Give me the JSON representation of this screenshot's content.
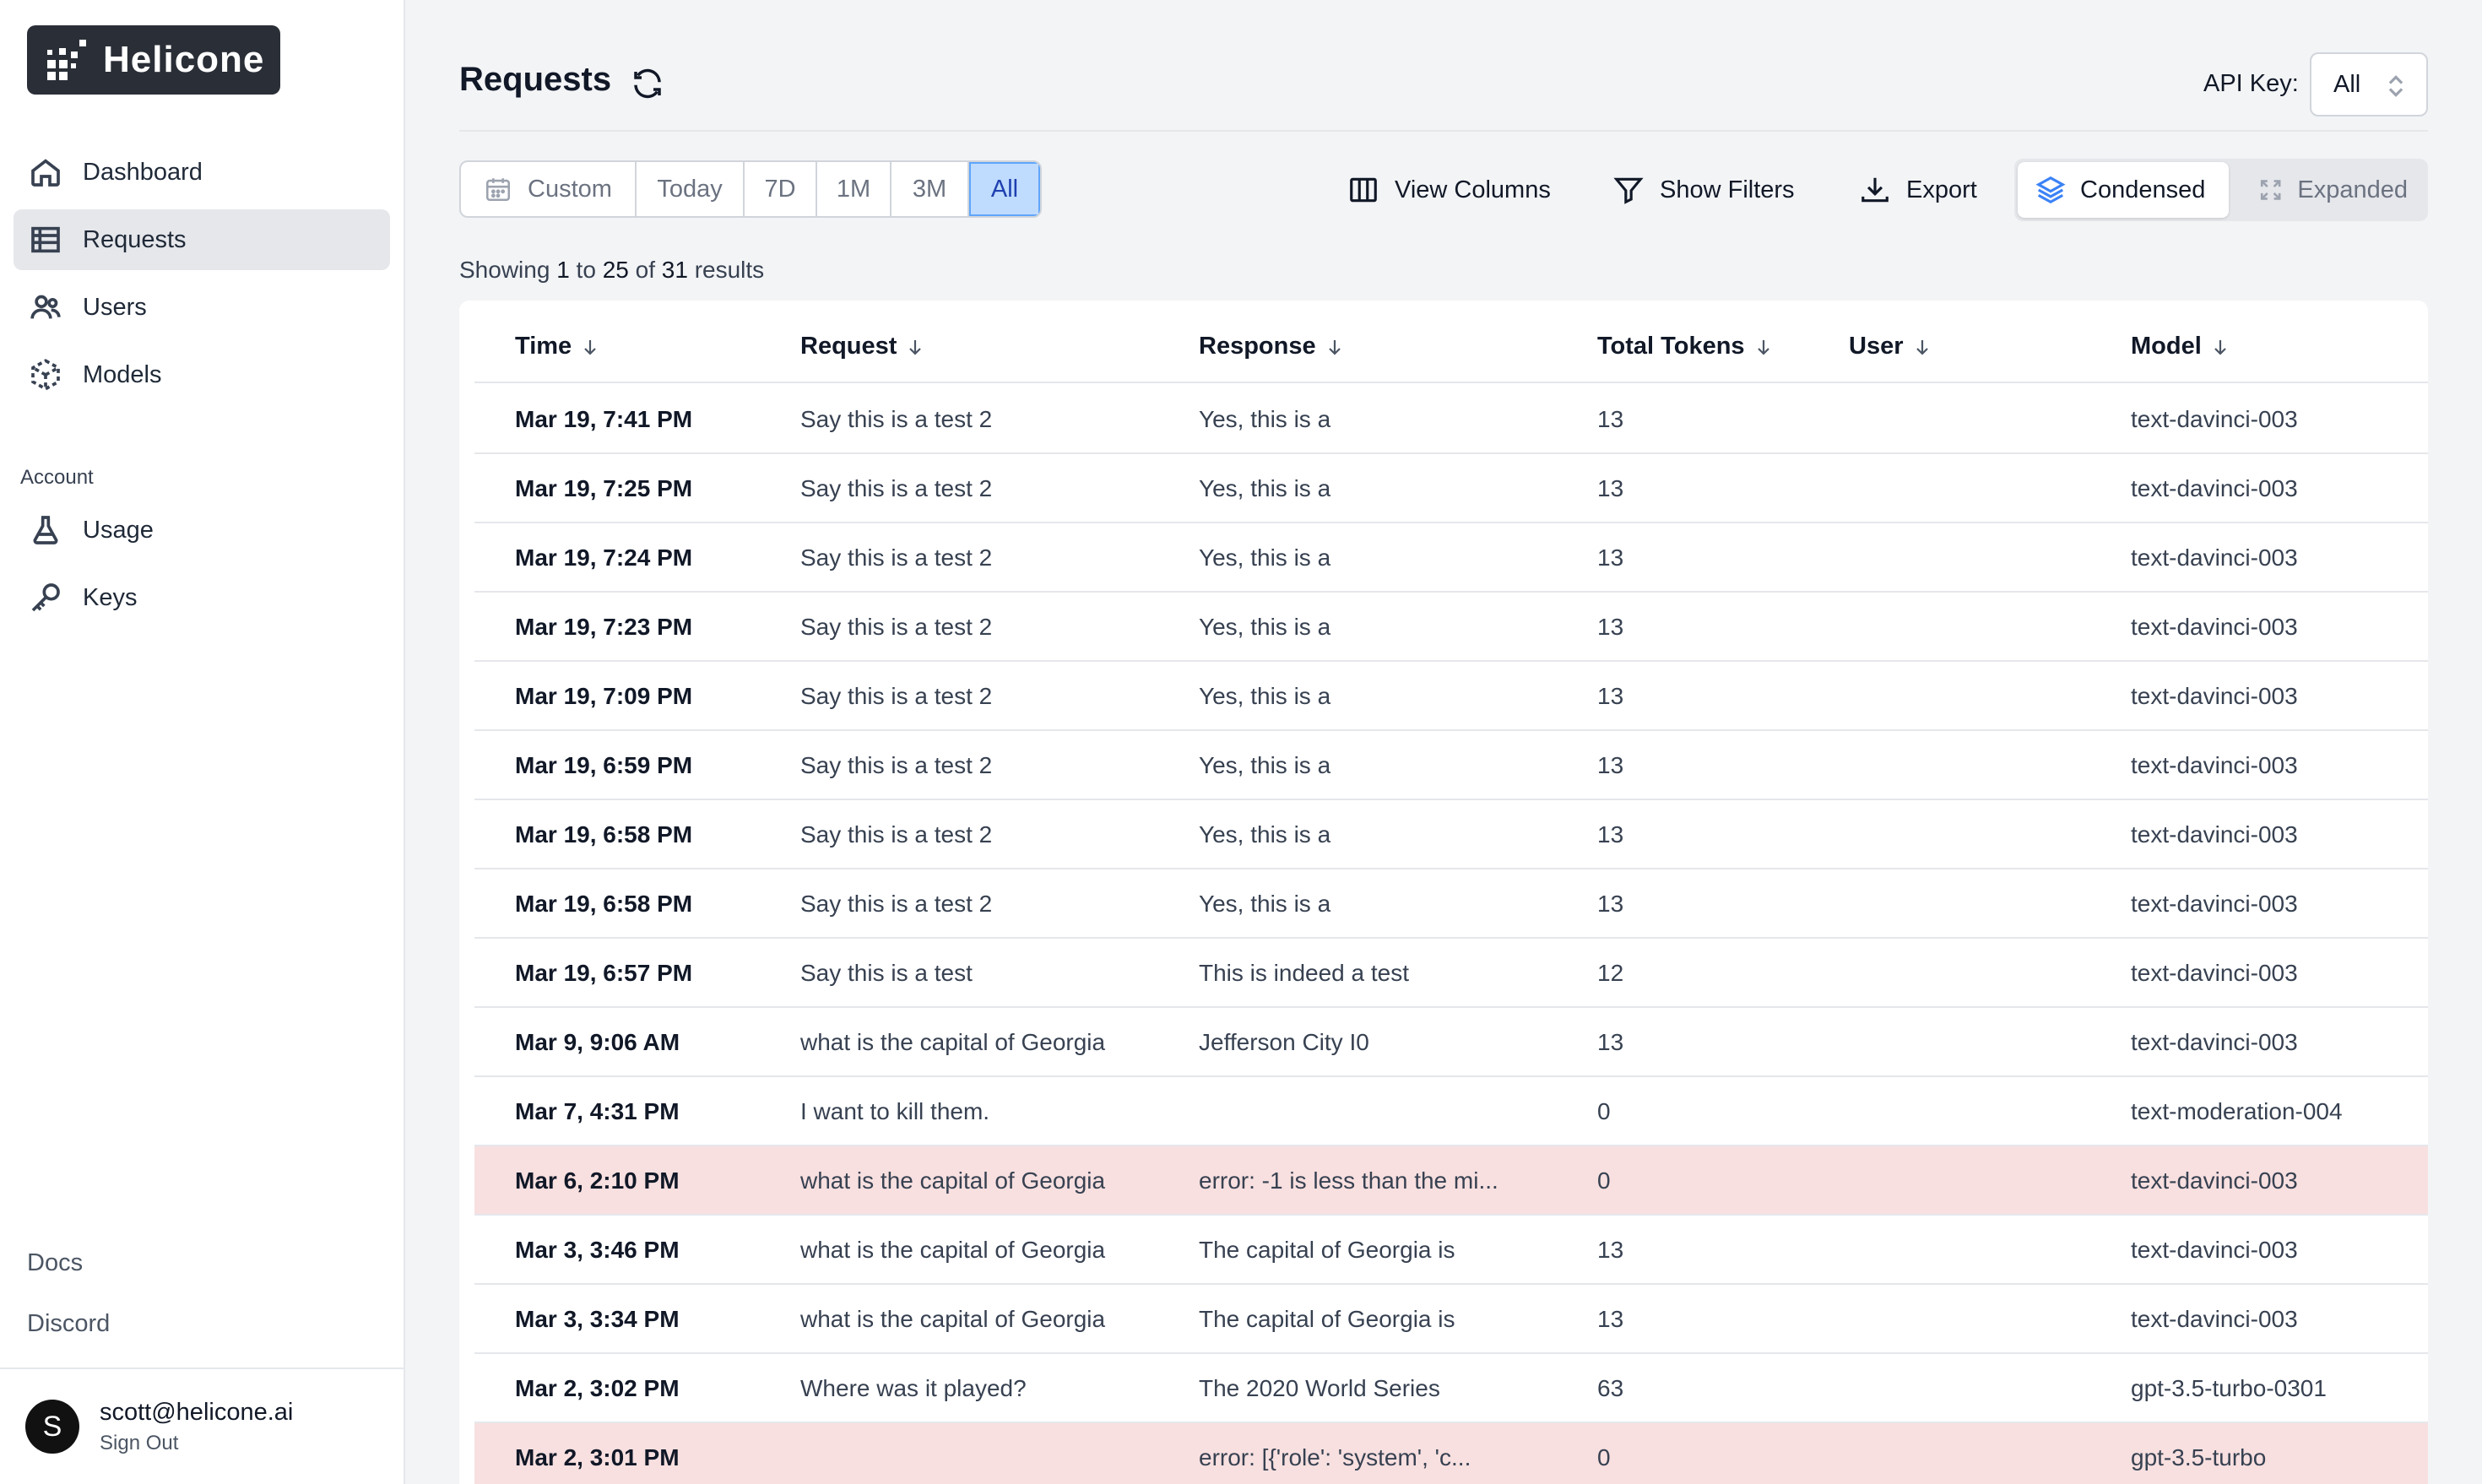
{
  "app": {
    "name": "Helicone"
  },
  "sidebar": {
    "nav": [
      {
        "label": "Dashboard",
        "icon": "home-icon"
      },
      {
        "label": "Requests",
        "icon": "table-icon",
        "active": true
      },
      {
        "label": "Users",
        "icon": "users-icon"
      },
      {
        "label": "Models",
        "icon": "cube-icon"
      }
    ],
    "account_label": "Account",
    "account_nav": [
      {
        "label": "Usage",
        "icon": "beaker-icon"
      },
      {
        "label": "Keys",
        "icon": "key-icon"
      }
    ],
    "docs_label": "Docs",
    "discord_label": "Discord",
    "user": {
      "initial": "S",
      "email": "scott@helicone.ai",
      "sign_out": "Sign Out"
    }
  },
  "header": {
    "title": "Requests",
    "api_key_label": "API Key:",
    "api_key_value": "All"
  },
  "toolbar": {
    "ranges": [
      "Custom",
      "Today",
      "7D",
      "1M",
      "3M",
      "All"
    ],
    "active_range": "All",
    "view_columns": "View Columns",
    "show_filters": "Show Filters",
    "export": "Export",
    "condensed": "Condensed",
    "expanded": "Expanded",
    "active_view": "Condensed"
  },
  "results": {
    "prefix": "Showing",
    "from": "1",
    "to_word": "to",
    "to": "25",
    "of_word": "of",
    "total": "31",
    "suffix": "results"
  },
  "table": {
    "columns": [
      "Time",
      "Request",
      "Response",
      "Total Tokens",
      "User",
      "Model"
    ],
    "rows": [
      {
        "time": "Mar 19, 7:41 PM",
        "request": "Say this is a test 2",
        "response": "Yes, this is a",
        "tokens": "13",
        "user": "",
        "model": "text-davinci-003",
        "error": false
      },
      {
        "time": "Mar 19, 7:25 PM",
        "request": "Say this is a test 2",
        "response": "Yes, this is a",
        "tokens": "13",
        "user": "",
        "model": "text-davinci-003",
        "error": false
      },
      {
        "time": "Mar 19, 7:24 PM",
        "request": "Say this is a test 2",
        "response": "Yes, this is a",
        "tokens": "13",
        "user": "",
        "model": "text-davinci-003",
        "error": false
      },
      {
        "time": "Mar 19, 7:23 PM",
        "request": "Say this is a test 2",
        "response": "Yes, this is a",
        "tokens": "13",
        "user": "",
        "model": "text-davinci-003",
        "error": false
      },
      {
        "time": "Mar 19, 7:09 PM",
        "request": "Say this is a test 2",
        "response": "Yes, this is a",
        "tokens": "13",
        "user": "",
        "model": "text-davinci-003",
        "error": false
      },
      {
        "time": "Mar 19, 6:59 PM",
        "request": "Say this is a test 2",
        "response": "Yes, this is a",
        "tokens": "13",
        "user": "",
        "model": "text-davinci-003",
        "error": false
      },
      {
        "time": "Mar 19, 6:58 PM",
        "request": "Say this is a test 2",
        "response": "Yes, this is a",
        "tokens": "13",
        "user": "",
        "model": "text-davinci-003",
        "error": false
      },
      {
        "time": "Mar 19, 6:58 PM",
        "request": "Say this is a test 2",
        "response": "Yes, this is a",
        "tokens": "13",
        "user": "",
        "model": "text-davinci-003",
        "error": false
      },
      {
        "time": "Mar 19, 6:57 PM",
        "request": "Say this is a test",
        "response": "This is indeed a test",
        "tokens": "12",
        "user": "",
        "model": "text-davinci-003",
        "error": false
      },
      {
        "time": "Mar 9, 9:06 AM",
        "request": "what is the capital of Georgia",
        "response": "Jefferson City I0",
        "tokens": "13",
        "user": "",
        "model": "text-davinci-003",
        "error": false
      },
      {
        "time": "Mar 7, 4:31 PM",
        "request": "I want to kill them.",
        "response": "",
        "tokens": "0",
        "user": "",
        "model": "text-moderation-004",
        "error": false
      },
      {
        "time": "Mar 6, 2:10 PM",
        "request": "what is the capital of Georgia",
        "response": "error: -1 is less than the mi...",
        "tokens": "0",
        "user": "",
        "model": "text-davinci-003",
        "error": true
      },
      {
        "time": "Mar 3, 3:46 PM",
        "request": "what is the capital of Georgia",
        "response": "The capital of Georgia is",
        "tokens": "13",
        "user": "",
        "model": "text-davinci-003",
        "error": false
      },
      {
        "time": "Mar 3, 3:34 PM",
        "request": "what is the capital of Georgia",
        "response": "The capital of Georgia is",
        "tokens": "13",
        "user": "",
        "model": "text-davinci-003",
        "error": false
      },
      {
        "time": "Mar 2, 3:02 PM",
        "request": "Where was it played?",
        "response": "The 2020 World Series",
        "tokens": "63",
        "user": "",
        "model": "gpt-3.5-turbo-0301",
        "error": false
      },
      {
        "time": "Mar 2, 3:01 PM",
        "request": "",
        "response": "error: [{'role': 'system', 'c...",
        "tokens": "0",
        "user": "",
        "model": "gpt-3.5-turbo",
        "error": true
      }
    ]
  },
  "colors": {
    "accent": "#60a5fa",
    "error_row": "#f8e0e0",
    "logo_bg": "#2a2f37"
  }
}
